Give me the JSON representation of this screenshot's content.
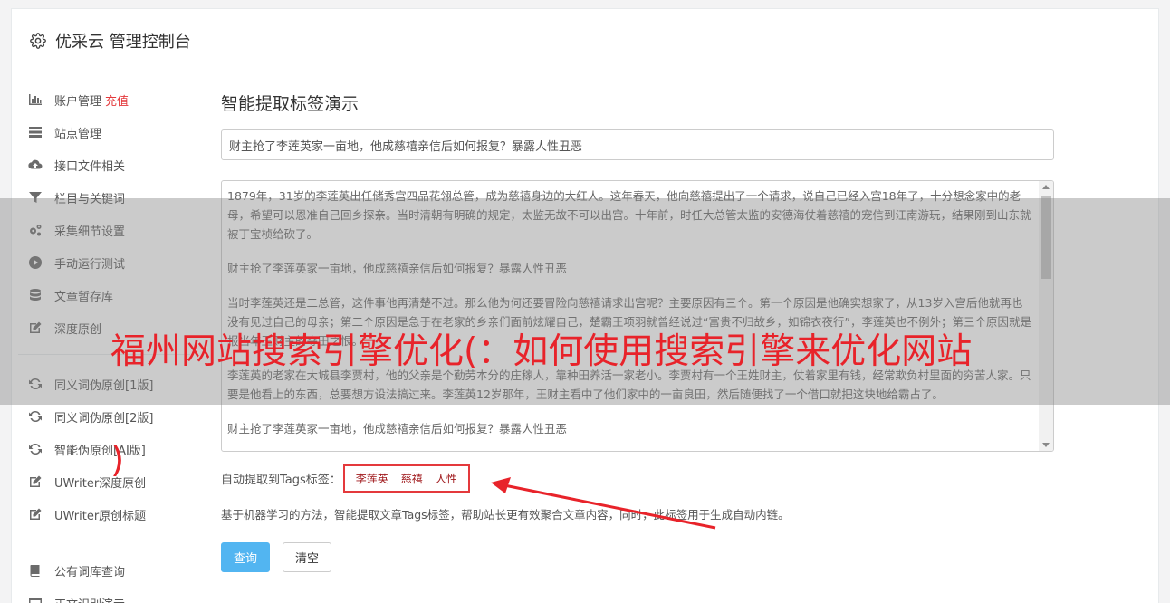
{
  "header": {
    "title": "优采云 管理控制台",
    "icon": "gear-icon"
  },
  "sidebar": {
    "items": [
      {
        "label": "账户管理",
        "badge": "充值",
        "icon": "bar-chart-icon"
      },
      {
        "label": "站点管理",
        "icon": "server-icon"
      },
      {
        "label": "接口文件相关",
        "icon": "cloud-upload-icon"
      },
      {
        "label": "栏目与关键词",
        "icon": "filter-icon"
      },
      {
        "label": "采集细节设置",
        "icon": "gears-icon"
      },
      {
        "label": "手动运行测试",
        "icon": "play-circle-icon"
      },
      {
        "label": "文章暂存库",
        "icon": "database-icon"
      },
      {
        "label": "深度原创",
        "icon": "edit-icon"
      }
    ],
    "items2": [
      {
        "label": "同义词伪原创[1版]",
        "icon": "refresh-icon"
      },
      {
        "label": "同义词伪原创[2版]",
        "icon": "refresh-icon"
      },
      {
        "label": "智能伪原创[AI版]",
        "icon": "refresh-icon"
      },
      {
        "label": "UWriter深度原创",
        "icon": "edit-icon"
      },
      {
        "label": "UWriter原创标题",
        "icon": "edit-icon"
      }
    ],
    "items3": [
      {
        "label": "公有词库查询",
        "icon": "book-icon"
      },
      {
        "label": "正文识别演示",
        "icon": "window-icon"
      }
    ]
  },
  "main": {
    "heading": "智能提取标签演示",
    "title_value": "财主抢了李莲英家一亩地，他成慈禧亲信后如何报复？暴露人性丑恶",
    "content_paragraphs": [
      "1879年，31岁的李莲英出任储秀宫四品花翎总管，成为慈禧身边的大红人。这年春天，他向慈禧提出了一个请求，说自己已经入宫18年了，十分想念家中的老母，希望可以恩准自己回乡探亲。当时清朝有明确的规定，太监无故不可以出宫。十年前，时任大总管太监的安德海仗着慈禧的宠信到江南游玩，结果刚到山东就被丁宝桢给砍了。",
      "财主抢了李莲英家一亩地，他成慈禧亲信后如何报复？暴露人性丑恶",
      "当时李莲英还是二总管，这件事他再清楚不过。那么他为何还要冒险向慈禧请求出宫呢？主要原因有三个。第一个原因是他确实想家了，从13岁入宫后他就再也没有见过自己的母亲；第二个原因是急于在老家的乡亲们面前炫耀自己，楚霸王项羽就曾经说过“富贵不归故乡，如锦衣夜行”，李莲英也不例外；第三个原因就是报当年王财主的夺田之恨。",
      "李莲英的老家在大城县李贾村，他的父亲是个勤劳本分的庄稼人，靠种田养活一家老小。李贾村有一个王姓财主，仗着家里有钱，经常欺负村里面的穷苦人家。只要是他看上的东西，总要想方设法搞过来。李莲英12岁那年，王财主看中了他们家中的一亩良田，然后随便找了一个借口就把这块地给霸占了。",
      "财主抢了李莲英家一亩地，他成慈禧亲信后如何报复？暴露人性丑恶"
    ],
    "tags_label": "自动提取到Tags标签：",
    "tags": [
      "李莲英",
      "慈禧",
      "人性"
    ],
    "description": "基于机器学习的方法，智能提取文章Tags标签，帮助站长更有效聚合文章内容，同时，此标签用于生成自动内链。",
    "query_button": "查询",
    "clear_button": "清空"
  },
  "overlay": {
    "text": "福州网站搜索引擎优化(：如何使用搜索引擎来优化网站",
    "text2": ")",
    "color": "#e8232a"
  }
}
